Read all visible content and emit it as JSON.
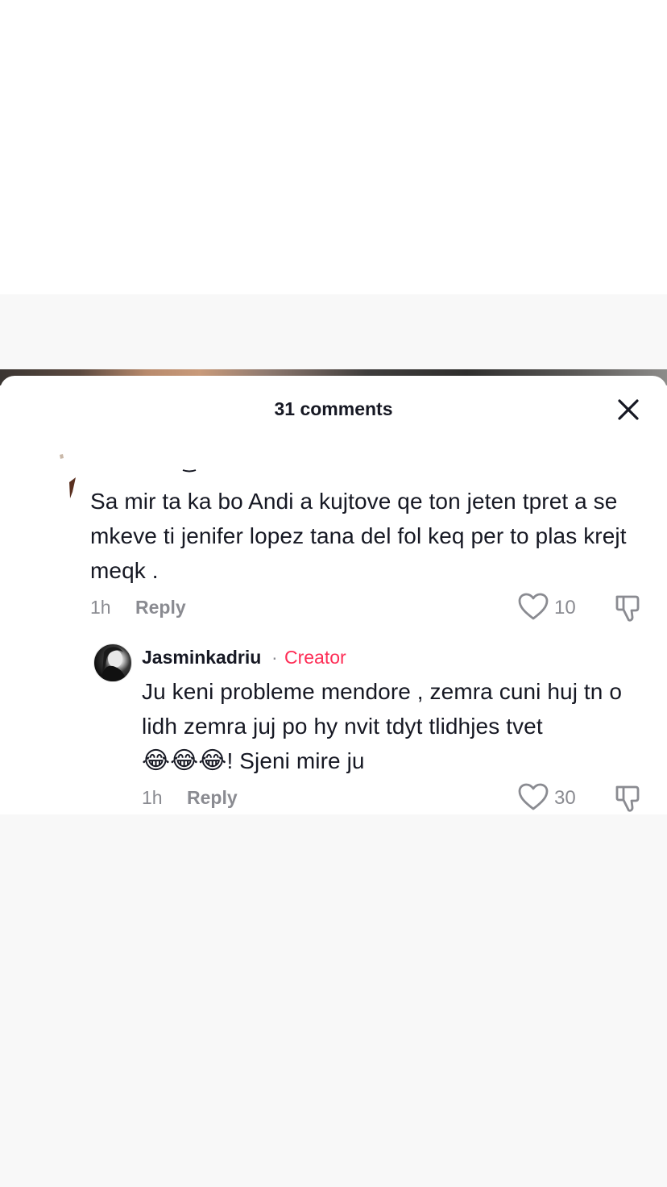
{
  "sheet": {
    "comments_count": "31 comments",
    "close_icon": "close-icon"
  },
  "comments": [
    {
      "text": "Sa mir ta ka bo Andi a kujtove qe ton jeten tpret a se mkeve ti jenifer lopez tana del fol keq per to plas krejt meqk .",
      "time": "1h",
      "reply_label": "Reply",
      "likes": "10",
      "like_icon": "heart-outline-icon",
      "dislike_icon": "thumbs-down-icon"
    }
  ],
  "replies": [
    {
      "username": "Jasminkadriu",
      "separator": "·",
      "badge": "Creator",
      "badge_color": "#fe2c55",
      "text_main": "Ju keni probleme mendore , zemra cuni huj tn o lidh zemra juj po hy nvit tdyt tlidhjes tvet",
      "emojis": "😂😂😂",
      "text_tail": "! Sjeni mire ju",
      "time": "1h",
      "reply_label": "Reply",
      "likes": "30",
      "like_icon": "heart-outline-icon",
      "dislike_icon": "thumbs-down-icon"
    }
  ]
}
